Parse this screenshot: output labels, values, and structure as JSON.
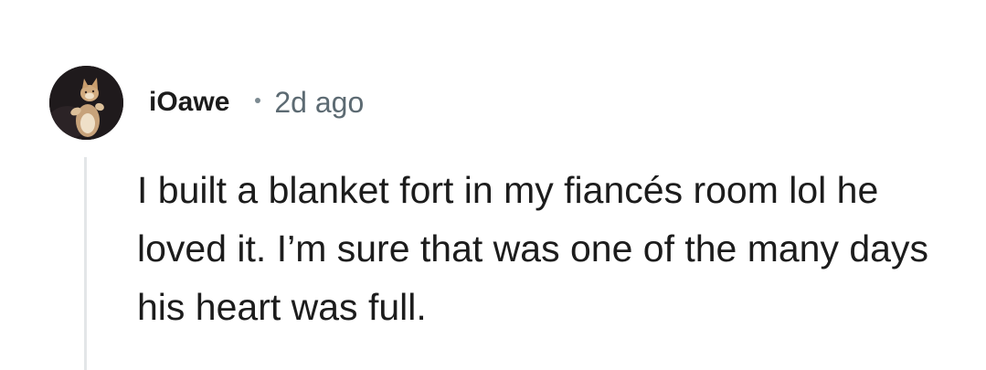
{
  "comment": {
    "username": "iOawe",
    "timestamp": "2d ago",
    "avatar_icon": "cat-avatar-icon",
    "body": "I built a blanket fort in my fiancés room lol he loved it. I’m sure that was one of the many days his heart was full."
  },
  "colors": {
    "background": "#ffffff",
    "text": "#1c1c1c",
    "meta_text": "#5c6a72",
    "thread_line": "#e3e6e8"
  }
}
